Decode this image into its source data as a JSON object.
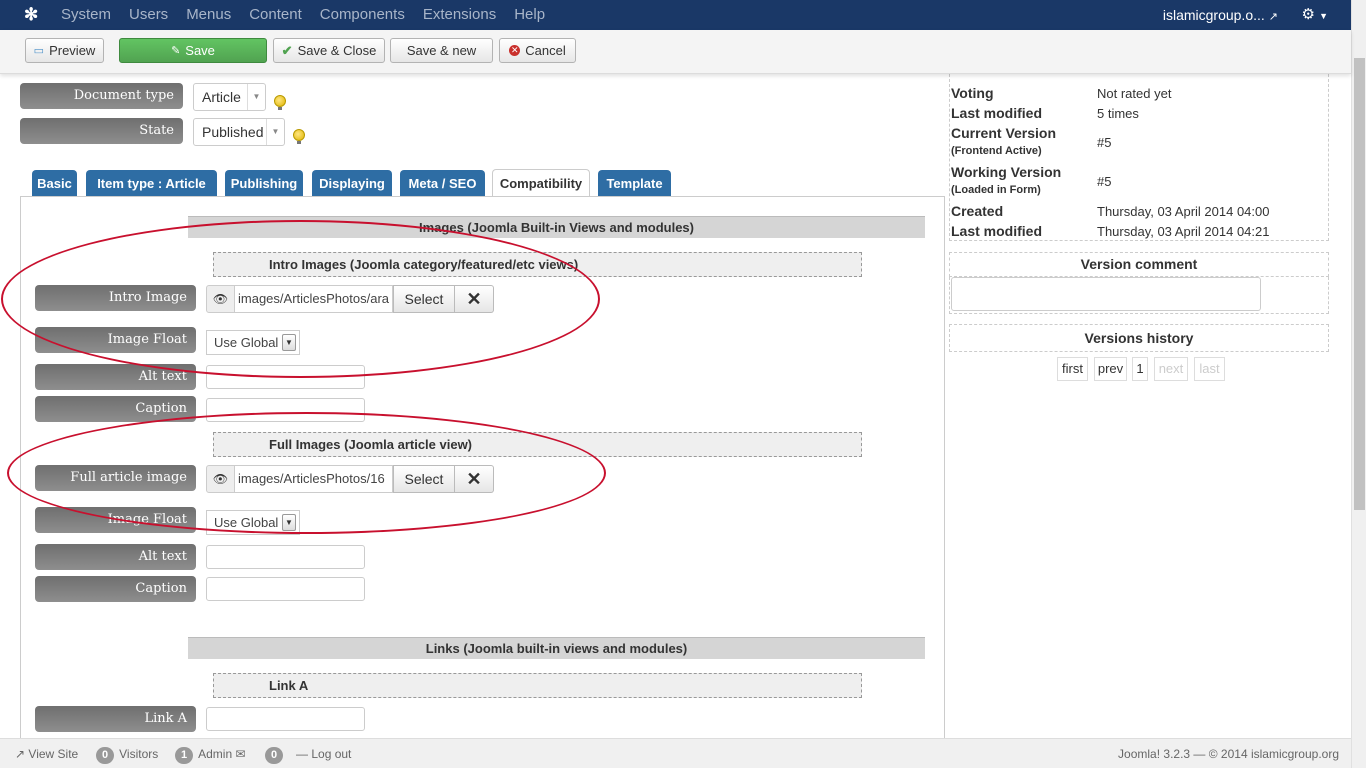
{
  "navbar": {
    "menu": [
      "System",
      "Users",
      "Menus",
      "Content",
      "Components",
      "Extensions",
      "Help"
    ],
    "site": "islamicgroup.o..."
  },
  "toolbar": {
    "preview": "Preview",
    "save": "Save",
    "save_close": "Save & Close",
    "save_new": "Save & new",
    "cancel": "Cancel"
  },
  "form": {
    "doctype_label": "Document type",
    "doctype_value": "Article",
    "state_label": "State",
    "state_value": "Published"
  },
  "tabs": [
    "Basic",
    "Item type : Article",
    "Publishing",
    "Displaying",
    "Meta / SEO",
    "Compatibility",
    "Template"
  ],
  "compat": {
    "images_header": "Images (Joomla Built-in Views and modules)",
    "intro_header": "Intro Images (Joomla category/featured/etc views)",
    "intro_image_label": "Intro Image",
    "intro_image_path": "images/ArticlesPhotos/ara",
    "select_label": "Select",
    "image_float_label": "Image Float",
    "image_float_value": "Use Global",
    "alt_text_label": "Alt text",
    "caption_label": "Caption",
    "full_header": "Full Images (Joomla article view)",
    "full_image_label": "Full article image",
    "full_image_path": "images/ArticlesPhotos/16",
    "links_header": "Links (Joomla built-in views and modules)",
    "link_a_header": "Link A",
    "link_a_label": "Link A"
  },
  "info": {
    "voting_k": "Voting",
    "voting_v": "Not rated yet",
    "modified_k": "Last modified",
    "modified_v": "5 times",
    "current_k": "Current Version",
    "current_sub": "(Frontend Active)",
    "current_v": "#5",
    "working_k": "Working Version",
    "working_sub": "(Loaded in Form)",
    "working_v": "#5",
    "created_k": "Created",
    "created_v": "Thursday, 03 April 2014 04:00",
    "lastmod_k": "Last modified",
    "lastmod_v": "Thursday, 03 April 2014 04:21"
  },
  "version_comment": "Version comment",
  "versions_history": "Versions history",
  "pagination": [
    "first",
    "prev",
    "1",
    "next",
    "last"
  ],
  "footer": {
    "view_site": "View Site",
    "visitors_count": "0",
    "visitors": "Visitors",
    "admin_count": "1",
    "admin": "Admin",
    "messages_count": "0",
    "logout": "Log out",
    "copyright": "Joomla! 3.2.3 — © 2014 islamicgroup.org"
  },
  "colors": {
    "navbar": "#1a3867",
    "tab": "#2e6da4",
    "save": "#51a351",
    "annotation": "#c8102e"
  }
}
